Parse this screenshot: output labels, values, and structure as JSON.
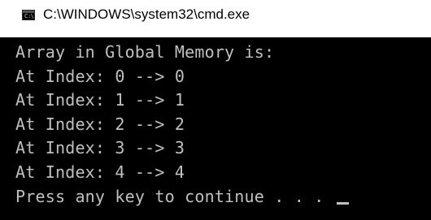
{
  "window": {
    "title": "C:\\WINDOWS\\system32\\cmd.exe",
    "icon_name": "console-icon",
    "icon_text": "C:\\"
  },
  "console": {
    "lines": [
      "Array in Global Memory is:",
      "At Index: 0 --> 0",
      "At Index: 1 --> 1",
      "At Index: 2 --> 2",
      "At Index: 3 --> 3",
      "At Index: 4 --> 4",
      "Press any key to continue . . . "
    ],
    "background_color": "#000000",
    "text_color": "#c0c0c0"
  }
}
